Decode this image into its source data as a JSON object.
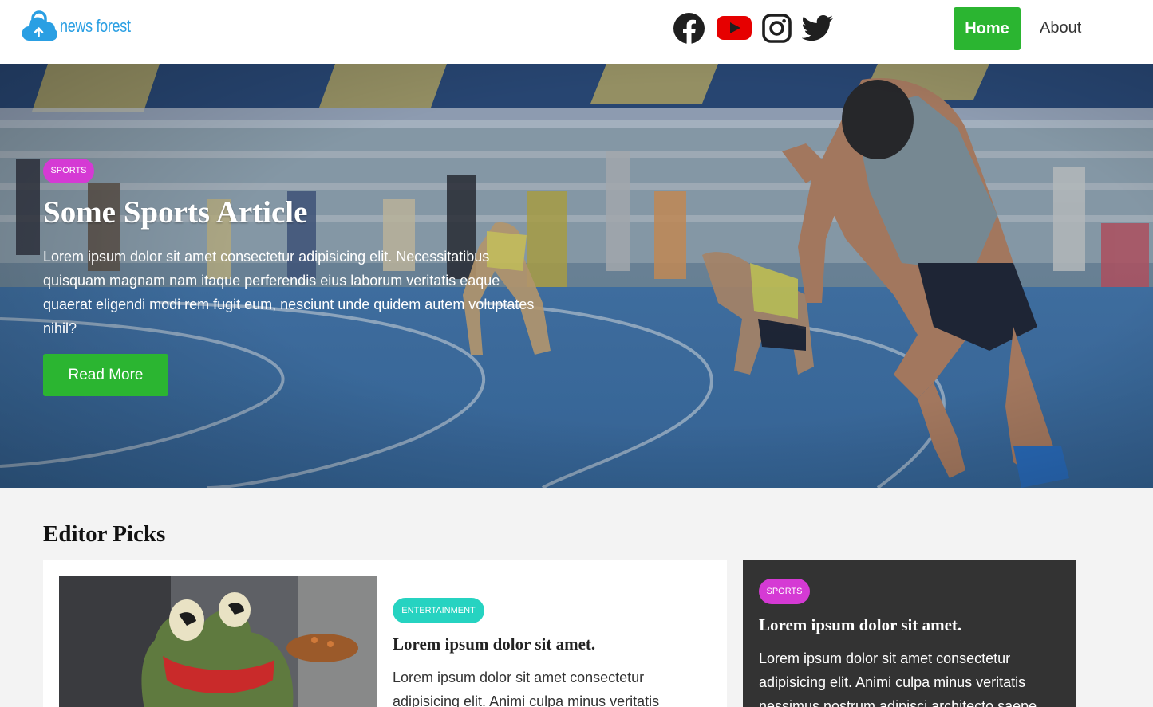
{
  "brand": {
    "name": "news forest",
    "logo_icon": "cloud-upload-lock-icon",
    "color": "#2a9fe3"
  },
  "social": [
    {
      "name": "facebook",
      "icon": "facebook-icon"
    },
    {
      "name": "youtube",
      "icon": "youtube-icon"
    },
    {
      "name": "instagram",
      "icon": "instagram-icon"
    },
    {
      "name": "twitter",
      "icon": "twitter-icon"
    }
  ],
  "nav": {
    "home": "Home",
    "about": "About",
    "active": "Home",
    "accent": "#2bb531"
  },
  "hero": {
    "category": "SPORTS",
    "title": "Some Sports Article",
    "text": "Lorem ipsum dolor sit amet consectetur adipisicing elit. Necessitatibus quisquam magnam nam itaque perferendis eius laborum veritatis eaque quaerat eligendi modi rem fugit eum, nesciunt unde quidem autem voluptates nihil?",
    "button": "Read More"
  },
  "editor_picks": {
    "heading": "Editor Picks",
    "main": {
      "category": "ENTERTAINMENT",
      "title": "Lorem ipsum dolor sit amet.",
      "text": "Lorem ipsum dolor sit amet consectetur adipisicing elit. Animi culpa minus veritatis"
    },
    "side": {
      "category": "SPORTS",
      "title": "Lorem ipsum dolor sit amet.",
      "text": "Lorem ipsum dolor sit amet consectetur adipisicing elit. Animi culpa minus veritatis nessimus nostrum adipisci architecto saepe"
    }
  },
  "colors": {
    "sports_badge": "#d53ad4",
    "entertainment_badge": "#26d3c1",
    "dark_card": "#333333"
  }
}
